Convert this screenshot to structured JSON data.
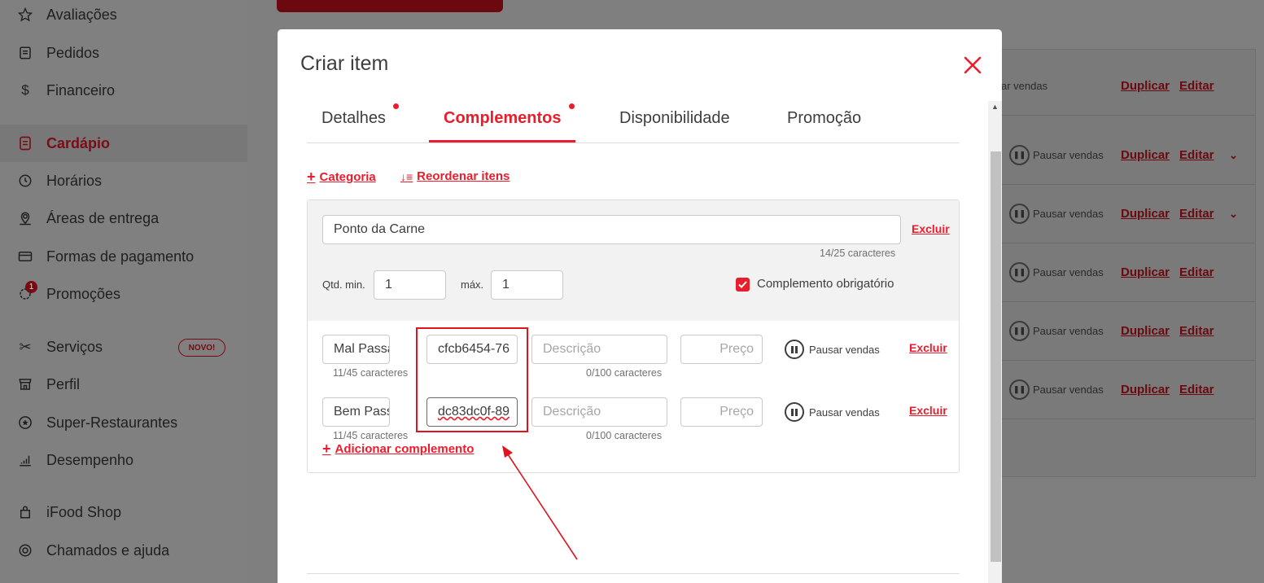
{
  "sidebar": {
    "items": [
      {
        "label": "Avaliações",
        "icon": "star-icon"
      },
      {
        "label": "Pedidos",
        "icon": "receipt-icon"
      },
      {
        "label": "Financeiro",
        "icon": "dollar-icon"
      },
      {
        "label": "Cardápio",
        "icon": "menu-book-icon",
        "active": true
      },
      {
        "label": "Horários",
        "icon": "clock-icon"
      },
      {
        "label": "Áreas de entrega",
        "icon": "map-pin-icon"
      },
      {
        "label": "Formas de pagamento",
        "icon": "credit-card-icon"
      },
      {
        "label": "Promoções",
        "icon": "promo-gear-icon",
        "badge": "1"
      },
      {
        "label": "Serviços",
        "icon": "scissors-icon",
        "tag": "NOVO!"
      },
      {
        "label": "Perfil",
        "icon": "storefront-icon"
      },
      {
        "label": "Super-Restaurantes",
        "icon": "star-circle-icon"
      },
      {
        "label": "Desempenho",
        "icon": "chart-bars-icon"
      },
      {
        "label": "iFood Shop",
        "icon": "shopping-bag-icon"
      },
      {
        "label": "Chamados e ajuda",
        "icon": "lifebuoy-icon"
      }
    ]
  },
  "background_list": {
    "first_row_partial": "ar vendas",
    "pause_label": "Pausar vendas",
    "duplicate_label": "Duplicar",
    "edit_label": "Editar"
  },
  "modal": {
    "title": "Criar item",
    "tabs": [
      {
        "label": "Detalhes",
        "has_dot": true
      },
      {
        "label": "Complementos",
        "has_dot": true,
        "active": true
      },
      {
        "label": "Disponibilidade",
        "has_dot": false
      },
      {
        "label": "Promoção",
        "has_dot": false
      }
    ],
    "actions": {
      "add_category": "Categoria",
      "reorder_items": "Reordenar itens"
    },
    "group": {
      "name": "Ponto da Carne",
      "name_counter": "14/25 caracteres",
      "delete_label": "Excluir",
      "qty_min_label": "Qtd. min.",
      "qty_min": "1",
      "qty_max_label": "máx.",
      "qty_max": "1",
      "required_label": "Complemento obrigatório",
      "required_checked": true
    },
    "complements": [
      {
        "name": "Mal Passado",
        "name_counter": "11/45 caracteres",
        "code": "cfcb6454-76",
        "description_placeholder": "Descrição",
        "description_counter": "0/100 caracteres",
        "price_placeholder": "Preço",
        "pause_label": "Pausar vendas",
        "delete_label": "Excluir"
      },
      {
        "name": "Bem Passado",
        "name_counter": "11/45 caracteres",
        "code": "dc83dc0f-89",
        "description_placeholder": "Descrição",
        "description_counter": "0/100 caracteres",
        "price_placeholder": "Preço",
        "pause_label": "Pausar vendas",
        "delete_label": "Excluir"
      }
    ],
    "add_complement": "Adicionar complemento"
  },
  "colors": {
    "accent": "#ea1d2c",
    "overlay": "#7f7f7f",
    "text": "#3e3e3e"
  }
}
